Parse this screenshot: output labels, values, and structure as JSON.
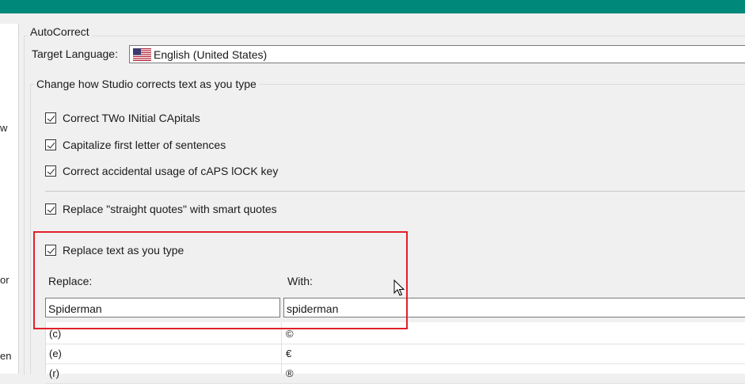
{
  "left_panel": {
    "fragments": [
      "w",
      "or",
      "en"
    ]
  },
  "group": {
    "title": "AutoCorrect",
    "target_language_label": "Target Language:",
    "target_language_value": "English (United States)",
    "target_language_flag": "us-flag-icon"
  },
  "subgroup": {
    "title": "Change how Studio corrects text as you type",
    "options": [
      {
        "label": "Correct TWo INitial CApitals",
        "checked": true
      },
      {
        "label": "Capitalize first letter of sentences",
        "checked": true
      },
      {
        "label": "Correct accidental usage of cAPS lOCK key",
        "checked": true
      },
      {
        "label": "Replace \"straight quotes\" with smart quotes",
        "checked": true
      }
    ]
  },
  "replace_section": {
    "toggle_label": "Replace text as you type",
    "checked": true,
    "replace_header": "Replace:",
    "with_header": "With:",
    "replace_value": "Spiderman",
    "with_value": "spiderman",
    "entries": [
      {
        "replace": "(c)",
        "with": "©"
      },
      {
        "replace": "(e)",
        "with": "€"
      },
      {
        "replace": "(r)",
        "with": "®"
      }
    ]
  },
  "colors": {
    "accent": "#00897b",
    "highlight": "#e0202a"
  }
}
